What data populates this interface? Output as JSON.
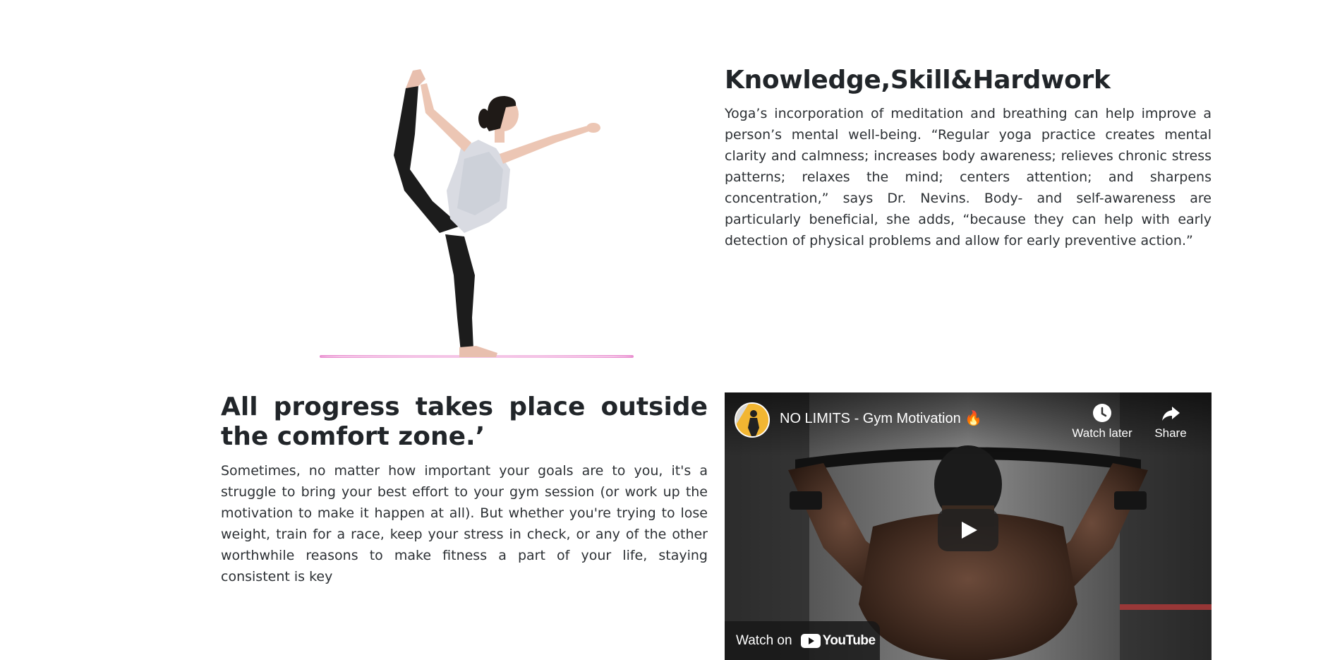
{
  "section1": {
    "heading": "Knowledge,Skill&Hardwork",
    "paragraph": "Yoga’s incorporation of meditation and breathing can help improve a person’s mental well-being. “Regular yoga practice creates mental clarity and calmness; increases body awareness; relieves chronic stress patterns; relaxes the mind; centers attention; and sharpens concentration,” says Dr. Nevins. Body- and self-awareness are particularly beneficial, she adds, “because they can help with early detection of physical problems and allow for early preventive action.”"
  },
  "section2": {
    "heading": "All progress takes place outside the comfort zone.’",
    "paragraph": "Sometimes, no matter how important your goals are to you, it's a struggle to bring your best effort to your gym session (or work up the motivation to make it happen at all). But whether you're trying to lose weight, train for a race, keep your stress in check, or any of the other worthwhile reasons to make fitness a part of your life, staying consistent is key"
  },
  "video": {
    "title": "NO LIMITS - Gym Motivation 🔥",
    "watch_later_label": "Watch later",
    "share_label": "Share",
    "watch_on_label": "Watch on",
    "youtube_label": "YouTube"
  },
  "colors": {
    "text": "#212529",
    "mat": "#e98fd0",
    "avatar_bg": "#f2b632"
  }
}
